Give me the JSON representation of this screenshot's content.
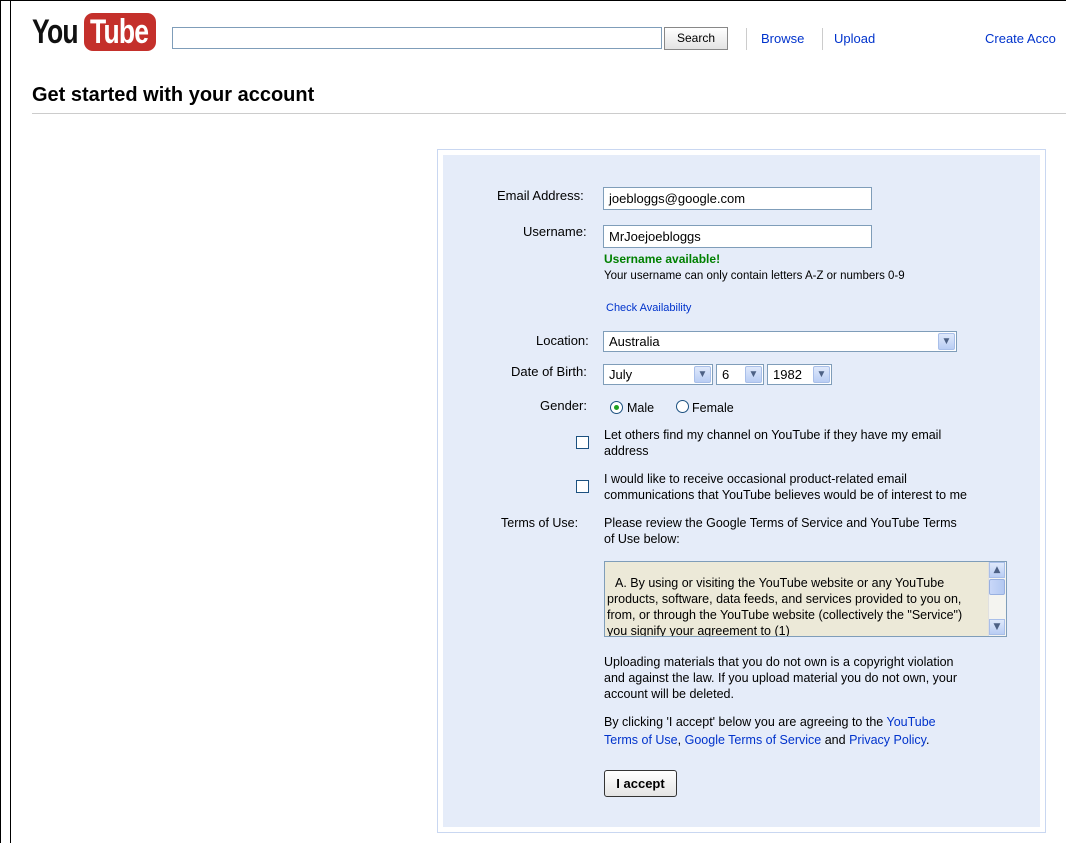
{
  "header": {
    "logo_you": "You",
    "logo_tube": "Tube",
    "search_button": "Search",
    "browse": "Browse",
    "upload": "Upload",
    "create_account": "Create Acco"
  },
  "page_title": "Get started with your account",
  "form": {
    "email_label": "Email Address:",
    "email_value": "joebloggs@google.com",
    "username_label": "Username:",
    "username_value": "MrJoejoebloggs",
    "username_status": "Username available!",
    "username_hint": "Your username can only contain letters A-Z or numbers 0-9",
    "check_availability": "Check Availability",
    "location_label": "Location:",
    "location_value": "Australia",
    "dob_label": "Date of Birth:",
    "dob_month": "July",
    "dob_day": "6",
    "dob_year": "1982",
    "gender_label": "Gender:",
    "gender_male": "Male",
    "gender_female": "Female",
    "gender_selected": "Male",
    "checkbox_find_line1": "Let others find my channel on YouTube if they have my email",
    "checkbox_find_line2": "address",
    "checkbox_email_line1": "I would like to receive occasional product-related email",
    "checkbox_email_line2": "communications that YouTube believes would be of interest to me",
    "terms_label": "Terms of Use:",
    "terms_intro_line1": "Please review the Google Terms of Service and YouTube Terms",
    "terms_intro_line2": "of Use below:",
    "tos_text": "A. By using or visiting the YouTube website or any YouTube products, software, data feeds, and services provided to you on, from, or through the YouTube website (collectively the \"Service\") you signify your agreement to (1)",
    "copyright_line1": "Uploading materials that you do not own is a copyright violation",
    "copyright_line2": "and against the law. If you upload material you do not own, your",
    "copyright_line3": "account will be deleted.",
    "agree_prefix": "By clicking 'I accept' below you are agreeing to the",
    "agree_yt_terms_1": "YouTube",
    "agree_yt_terms_2": "Terms of Use",
    "agree_comma": ",",
    "agree_google_terms": "Google Terms of Service",
    "agree_and": "and",
    "agree_privacy": "Privacy Policy",
    "agree_period": ".",
    "accept_button": "I accept"
  },
  "colors": {
    "brand_red": "#c4302b",
    "link": "#0033cc",
    "panel_bg": "#e5ecf9",
    "available_green": "#008000"
  }
}
